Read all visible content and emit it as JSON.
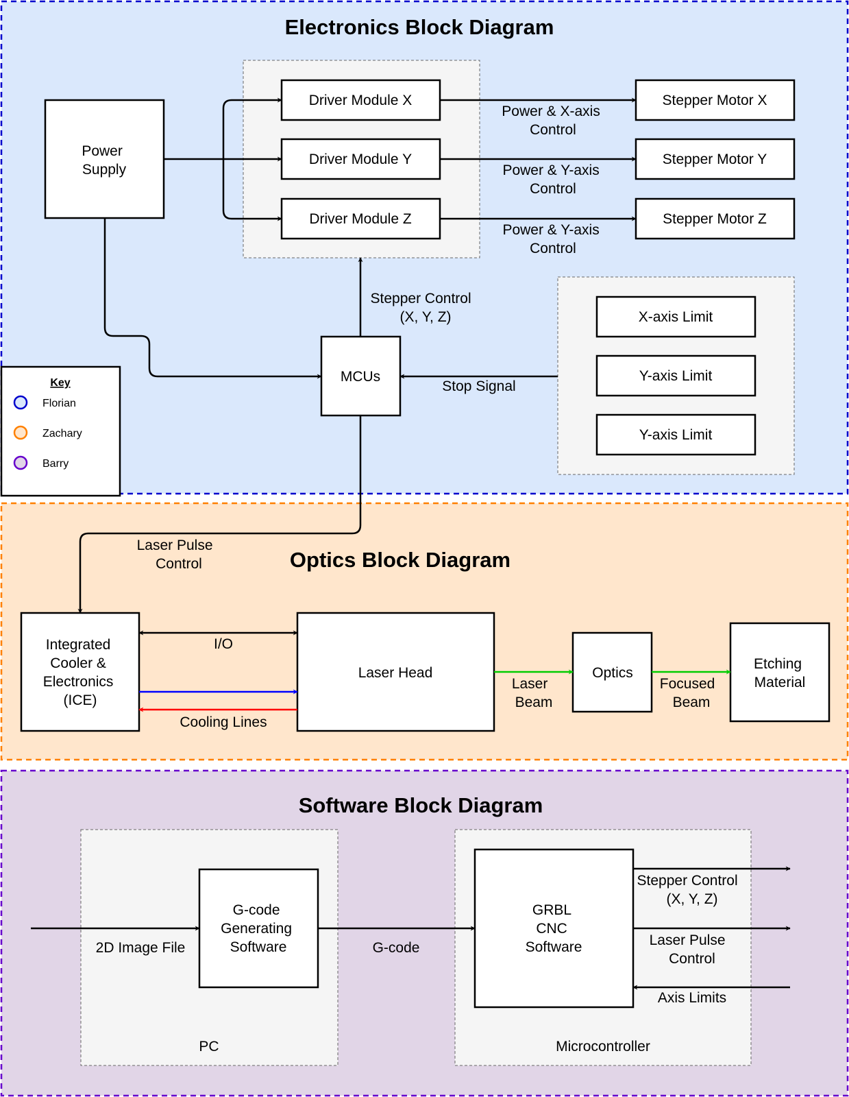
{
  "colors": {
    "electronics_bg": "#dae8fc",
    "electronics_border": "#0000cc",
    "optics_bg": "#ffe6cc",
    "optics_border": "#ff8000",
    "software_bg": "#e1d5e7",
    "software_border": "#6600cc",
    "group_bg": "#f5f5f5",
    "laser_green": "#00cc00",
    "cool_blue": "#0000ff",
    "cool_red": "#ff0000"
  },
  "electronics": {
    "title": "Electronics Block Diagram",
    "power_supply": [
      "Power",
      "Supply"
    ],
    "driver_x": "Driver Module X",
    "driver_y": "Driver Module Y",
    "driver_z": "Driver Module Z",
    "motor_x": "Stepper Motor X",
    "motor_y": "Stepper Motor Y",
    "motor_z": "Stepper Motor Z",
    "label_x": [
      "Power & X-axis",
      "Control"
    ],
    "label_y": [
      "Power & Y-axis",
      "Control"
    ],
    "label_z": [
      "Power & Y-axis",
      "Control"
    ],
    "stepper_control": [
      "Stepper Control",
      "(X, Y, Z)"
    ],
    "mcus": "MCUs",
    "stop_signal": "Stop Signal",
    "limit_x": "X-axis Limit",
    "limit_y": "Y-axis Limit",
    "limit_y2": "Y-axis Limit"
  },
  "key": {
    "title": "Key",
    "items": [
      {
        "label": "Florian",
        "stroke": "#0000cc",
        "fill": "#dae8fc"
      },
      {
        "label": "Zachary",
        "stroke": "#ff8000",
        "fill": "#ffe6cc"
      },
      {
        "label": "Barry",
        "stroke": "#6600cc",
        "fill": "#e1d5e7"
      }
    ]
  },
  "optics": {
    "title": "Optics Block Diagram",
    "laser_pulse": [
      "Laser Pulse",
      "Control"
    ],
    "ice": [
      "Integrated",
      "Cooler &",
      "Electronics",
      "(ICE)"
    ],
    "io": "I/O",
    "cooling": "Cooling Lines",
    "laser_head": "Laser Head",
    "laser_beam": [
      "Laser",
      "Beam"
    ],
    "optics_block": "Optics",
    "focused_beam": [
      "Focused",
      "Beam"
    ],
    "etching": [
      "Etching",
      "Material"
    ]
  },
  "software": {
    "title": "Software Block Diagram",
    "image_file": "2D Image File",
    "gcode_sw": [
      "G-code",
      "Generating",
      "Software"
    ],
    "gcode": "G-code",
    "grbl": [
      "GRBL",
      "CNC",
      "Software"
    ],
    "stepper_control": [
      "Stepper Control",
      "(X, Y, Z)"
    ],
    "laser_pulse": [
      "Laser Pulse",
      "Control"
    ],
    "axis_limits": "Axis Limits",
    "pc": "PC",
    "microcontroller": "Microcontroller"
  }
}
